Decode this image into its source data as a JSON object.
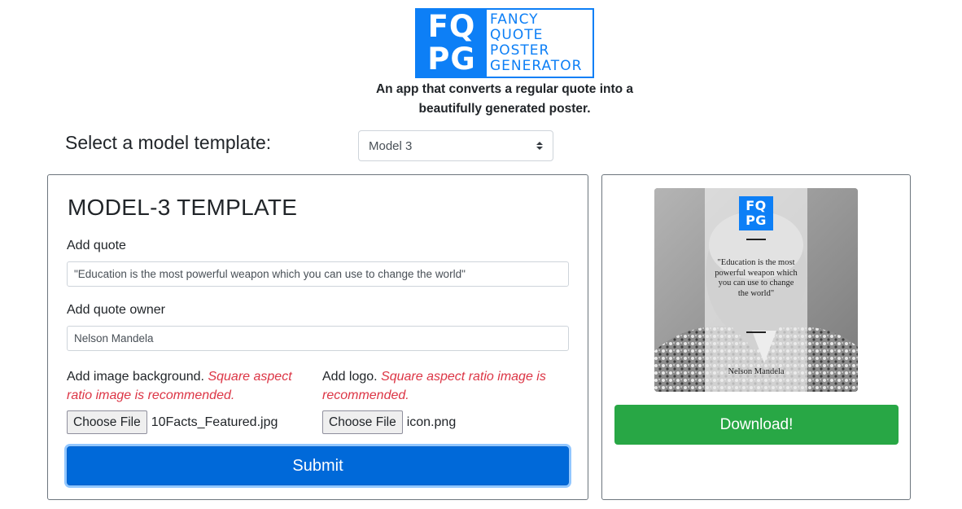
{
  "logo": {
    "mark_line1": "FQ",
    "mark_line2": "PG",
    "words": [
      "FANCY",
      "QUOTE",
      "POSTER",
      "GENERATOR"
    ]
  },
  "tagline": "An app that converts a regular quote into a beautifully generated poster.",
  "selector": {
    "label": "Select a model template:",
    "selected": "Model 3"
  },
  "form": {
    "title": "MODEL-3 TEMPLATE",
    "quote_label": "Add quote",
    "quote_value": "\"Education is the most powerful weapon which you can use to change the world\"",
    "owner_label": "Add quote owner",
    "owner_value": "Nelson Mandela",
    "background_label": "Add image background.",
    "background_hint": "Square aspect ratio image is recommended.",
    "logo_label": "Add logo.",
    "logo_hint": "Square aspect ratio image is recommended.",
    "choose_file_label": "Choose File",
    "background_file": "10Facts_Featured.jpg",
    "logo_file": "icon.png",
    "submit_label": "Submit"
  },
  "preview": {
    "logo_line1": "FQ",
    "logo_line2": "PG",
    "quote": "\"Education is the most powerful weapon which you can use to change the world\"",
    "owner": "Nelson Mandela",
    "download_label": "Download!"
  },
  "colors": {
    "brand_blue": "#0d7ff6",
    "submit_blue": "#0069d9",
    "download_green": "#28a745",
    "hint_red": "#dc3545"
  }
}
